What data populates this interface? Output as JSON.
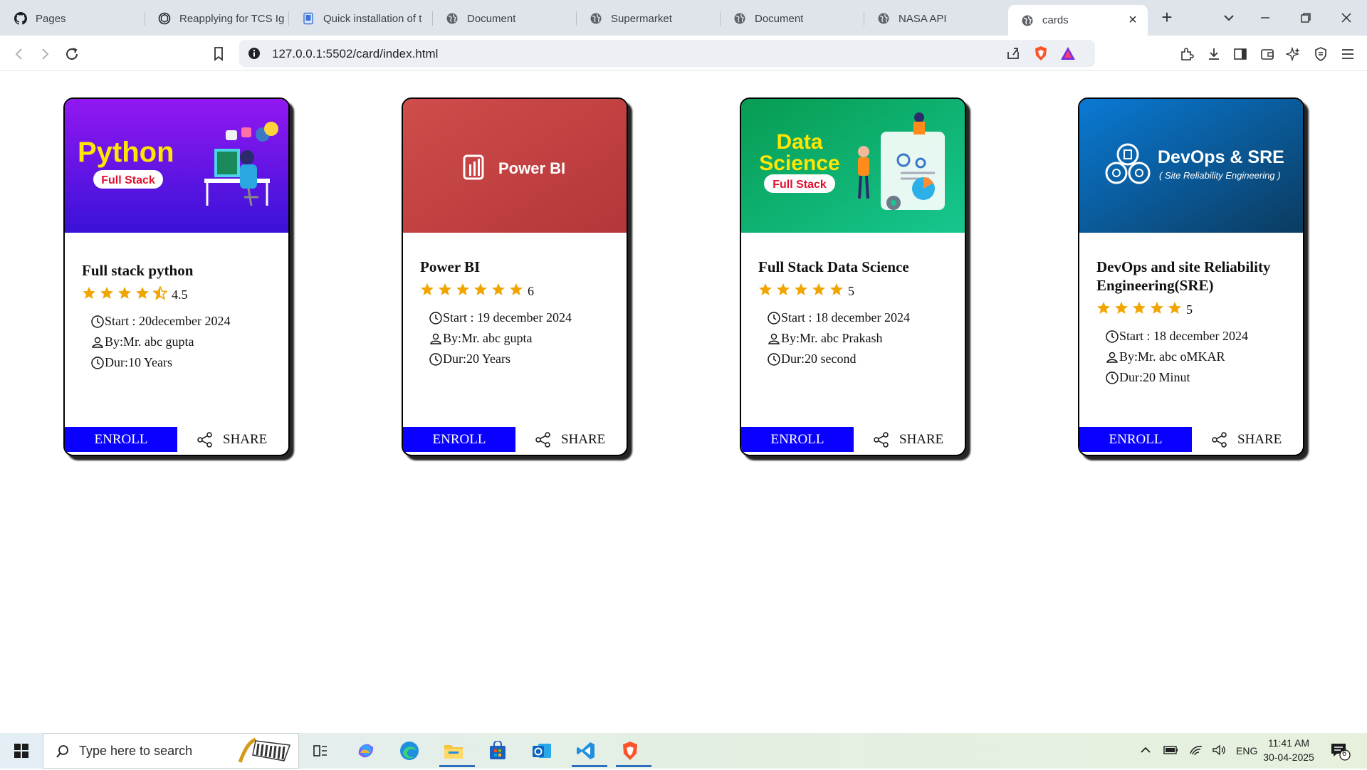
{
  "browser": {
    "tabs": [
      {
        "label": "Pages",
        "icon": "github-icon"
      },
      {
        "label": "Reapplying for TCS Ig",
        "icon": "openai-icon"
      },
      {
        "label": "Quick installation of t",
        "icon": "document-icon"
      },
      {
        "label": "Document",
        "icon": "globe-icon"
      },
      {
        "label": "Supermarket",
        "icon": "globe-icon"
      },
      {
        "label": "Document",
        "icon": "globe-icon"
      },
      {
        "label": "NASA API",
        "icon": "globe-icon"
      },
      {
        "label": "cards",
        "icon": "globe-icon"
      }
    ],
    "active_tab": 7,
    "url": "127.0.0.1:5502/card/index.html"
  },
  "cards": [
    {
      "banner": {
        "title": "Python",
        "badge": "Full Stack",
        "gradient": [
          "#8f1bf0",
          "#3a12d8"
        ],
        "title_color": "#ffe600"
      },
      "title": "Full stack python",
      "rating": "4.5",
      "stars": 4.5,
      "start": "Start : 20december 2024",
      "by": "By:Mr. abc gupta",
      "dur": "Dur:10 Years",
      "enroll": "ENROLL",
      "share": "SHARE"
    },
    {
      "banner": {
        "title": "Power BI",
        "gradient": [
          "#cc4a48",
          "#b8383c"
        ]
      },
      "title": "Power BI",
      "rating": "6",
      "stars": 6,
      "start": "Start : 19 december 2024",
      "by": "By:Mr. abc gupta",
      "dur": "Dur:20 Years",
      "enroll": "ENROLL",
      "share": "SHARE"
    },
    {
      "banner": {
        "title_line1": "Data",
        "title_line2": "Science",
        "badge": "Full Stack",
        "gradient": [
          "#0aa95a",
          "#13c48a"
        ],
        "title_color": "#ffe600"
      },
      "title": "Full Stack Data Science",
      "rating": "5",
      "stars": 5,
      "start": "Start : 18 december 2024",
      "by": "By:Mr. abc Prakash",
      "dur": "Dur:20 second",
      "enroll": "ENROLL",
      "share": "SHARE"
    },
    {
      "banner": {
        "title": "DevOps & SRE",
        "subtitle": "( Site Reliability Engineering )",
        "gradient": [
          "#0a73c8",
          "#0b3f66"
        ]
      },
      "title": "DevOps and site Reliability Engineering(SRE)",
      "rating": "5",
      "stars": 5,
      "start": "Start : 18 december 2024",
      "by": "By:Mr. abc oMKAR",
      "dur": "Dur:20 Minut",
      "enroll": "ENROLL",
      "share": "SHARE"
    }
  ],
  "taskbar": {
    "search_placeholder": "Type here to search",
    "language": "ENG",
    "time": "11:41 AM",
    "date": "30-04-2025",
    "notifications": "6"
  },
  "colors": {
    "enroll_bg": "#0a00ff",
    "star": "#f0a500"
  }
}
